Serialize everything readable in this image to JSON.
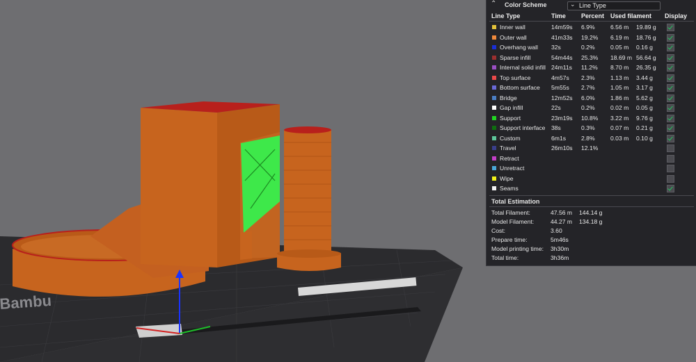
{
  "panel": {
    "title": "Color Scheme",
    "scheme_value": "Line Type",
    "headers": {
      "line_type": "Line Type",
      "time": "Time",
      "percent": "Percent",
      "used_filament": "Used filament",
      "display": "Display"
    },
    "rows": [
      {
        "name": "Inner wall",
        "color": "#e3c23a",
        "time": "14m59s",
        "percent": "6.9%",
        "length": "6.56 m",
        "weight": "19.89 g",
        "display": true
      },
      {
        "name": "Outer wall",
        "color": "#f08a3c",
        "time": "41m33s",
        "percent": "19.2%",
        "length": "6.19 m",
        "weight": "18.76 g",
        "display": true
      },
      {
        "name": "Overhang wall",
        "color": "#1a2fd6",
        "time": "32s",
        "percent": "0.2%",
        "length": "0.05 m",
        "weight": "0.16 g",
        "display": true
      },
      {
        "name": "Sparse infill",
        "color": "#9b2f2f",
        "time": "54m44s",
        "percent": "25.3%",
        "length": "18.69 m",
        "weight": "56.64 g",
        "display": true
      },
      {
        "name": "Internal solid infill",
        "color": "#9a4fc4",
        "time": "24m11s",
        "percent": "11.2%",
        "length": "8.70 m",
        "weight": "26.35 g",
        "display": true
      },
      {
        "name": "Top surface",
        "color": "#ec4a4a",
        "time": "4m57s",
        "percent": "2.3%",
        "length": "1.13 m",
        "weight": "3.44 g",
        "display": true
      },
      {
        "name": "Bottom surface",
        "color": "#6a6ad8",
        "time": "5m55s",
        "percent": "2.7%",
        "length": "1.05 m",
        "weight": "3.17 g",
        "display": true
      },
      {
        "name": "Bridge",
        "color": "#4b7fc4",
        "time": "12m52s",
        "percent": "6.0%",
        "length": "1.86 m",
        "weight": "5.62 g",
        "display": true
      },
      {
        "name": "Gap infill",
        "color": "#ffffff",
        "time": "22s",
        "percent": "0.2%",
        "length": "0.02 m",
        "weight": "0.05 g",
        "display": true
      },
      {
        "name": "Support",
        "color": "#22d622",
        "time": "23m19s",
        "percent": "10.8%",
        "length": "3.22 m",
        "weight": "9.76 g",
        "display": true
      },
      {
        "name": "Support interface",
        "color": "#0f6e10",
        "time": "38s",
        "percent": "0.3%",
        "length": "0.07 m",
        "weight": "0.21 g",
        "display": true
      },
      {
        "name": "Custom",
        "color": "#5ec79b",
        "time": "6m1s",
        "percent": "2.8%",
        "length": "0.03 m",
        "weight": "0.10 g",
        "display": true
      },
      {
        "name": "Travel",
        "color": "#3a3f8c",
        "time": "26m10s",
        "percent": "12.1%",
        "length": "",
        "weight": "",
        "display": false
      },
      {
        "name": "Retract",
        "color": "#c43fc8",
        "time": "",
        "percent": "",
        "length": "",
        "weight": "",
        "display": false
      },
      {
        "name": "Unretract",
        "color": "#4aa8d8",
        "time": "",
        "percent": "",
        "length": "",
        "weight": "",
        "display": false
      },
      {
        "name": "Wipe",
        "color": "#f2f21a",
        "time": "",
        "percent": "",
        "length": "",
        "weight": "",
        "display": false
      },
      {
        "name": "Seams",
        "color": "#f2f2f2",
        "time": "",
        "percent": "",
        "length": "",
        "weight": "",
        "display": true
      }
    ],
    "total_title": "Total Estimation",
    "totals": [
      {
        "label": "Total Filament:",
        "v1": "47.56 m",
        "v2": "144.14 g"
      },
      {
        "label": "Model Filament:",
        "v1": "44.27 m",
        "v2": "134.18 g"
      },
      {
        "label": "Cost:",
        "v1": "3.60",
        "v2": ""
      },
      {
        "label": "Prepare time:",
        "v1": "5m46s",
        "v2": ""
      },
      {
        "label": "Model printing time:",
        "v1": "3h30m",
        "v2": ""
      },
      {
        "label": "Total time:",
        "v1": "3h36m",
        "v2": ""
      }
    ]
  },
  "viewport": {
    "plate_text": "Bambu",
    "colors": {
      "body": "#c7641e",
      "body_dark": "#a94f14",
      "top": "#b8201c",
      "support": "#3ee84a",
      "background": "#6e6e71",
      "plate": "#2a2a2d"
    }
  }
}
